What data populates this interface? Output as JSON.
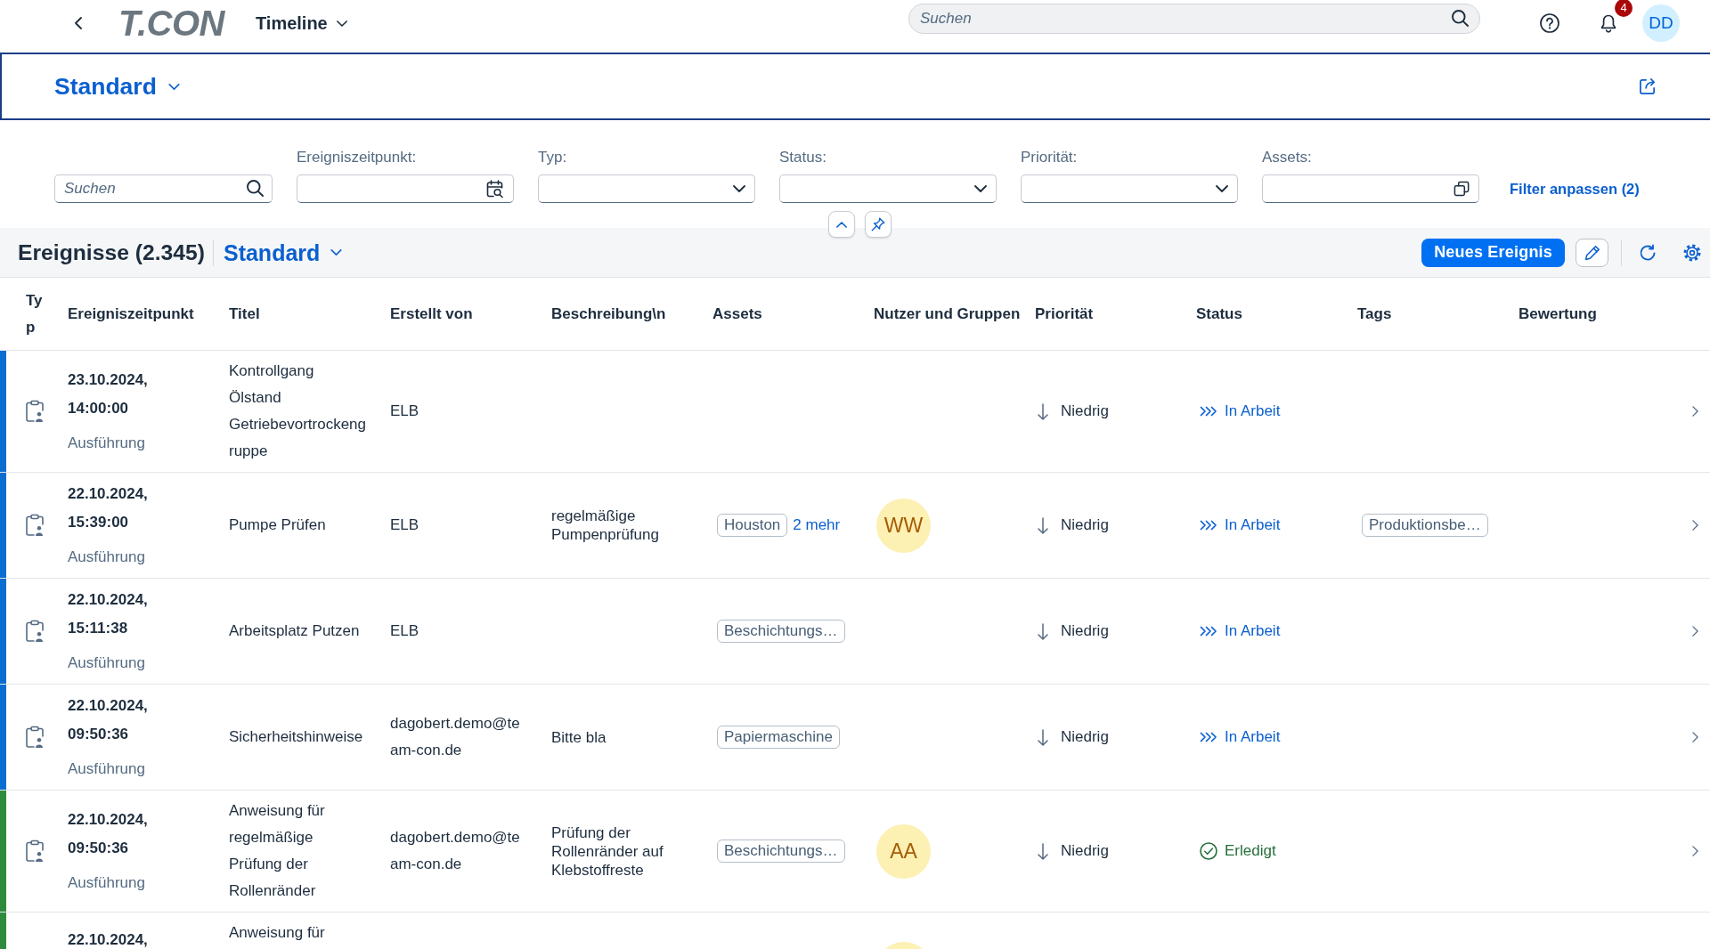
{
  "shell": {
    "logo": "T.CON",
    "app_title": "Timeline",
    "search": {
      "placeholder": "Suchen"
    },
    "notifications": {
      "count": "4"
    },
    "user": {
      "initials": "DD"
    }
  },
  "variant_header": {
    "title": "Standard"
  },
  "filter_bar": {
    "search": {
      "placeholder": "Suchen"
    },
    "fields": [
      {
        "label": "Ereigniszeitpunkt:",
        "kind": "date"
      },
      {
        "label": "Typ:",
        "kind": "select"
      },
      {
        "label": "Status:",
        "kind": "select"
      },
      {
        "label": "Priorität:",
        "kind": "select"
      },
      {
        "label": "Assets:",
        "kind": "value_help"
      }
    ],
    "adapt_filters": "Filter anpassen (2)"
  },
  "table": {
    "title": "Ereignisse (2.345)",
    "variant": "Standard",
    "create_button": "Neues Ereignis",
    "columns": [
      "Typ",
      "Ereigniszeitpunkt",
      "Titel",
      "Erstellt von",
      "Beschreibung\\n",
      "Assets",
      "Nutzer und Gruppen",
      "Priorität",
      "Status",
      "Tags",
      "Bewertung"
    ],
    "rows": [
      {
        "color": "#0a6ed1",
        "type": "Ausführung",
        "date": "23.10.2024,",
        "time": "14:00:00",
        "title": "Kontrollgang Ölstand Getriebevortrockengruppe",
        "created_by": "ELB",
        "priority": {
          "kind": "low",
          "label": "Niedrig"
        },
        "status": {
          "kind": "in_progress",
          "label": "In Arbeit"
        }
      },
      {
        "color": "#0a6ed1",
        "type": "Ausführung",
        "date": "22.10.2024,",
        "time": "15:39:00",
        "title": "Pumpe Prüfen",
        "created_by": "ELB",
        "description": "regelmäßige Pumpenprüfung",
        "assets": {
          "items": [
            "Houston"
          ],
          "more": "2 mehr"
        },
        "users": [
          {
            "kind": "avatar",
            "initials": "WW"
          }
        ],
        "priority": {
          "kind": "low",
          "label": "Niedrig"
        },
        "status": {
          "kind": "in_progress",
          "label": "In Arbeit"
        },
        "tags": [
          "Produktionsbe…"
        ]
      },
      {
        "color": "#0a6ed1",
        "type": "Ausführung",
        "date": "22.10.2024,",
        "time": "15:11:38",
        "title": "Arbeitsplatz Putzen",
        "created_by": "ELB",
        "assets": {
          "items": [
            "Beschichtungs…"
          ]
        },
        "priority": {
          "kind": "low",
          "label": "Niedrig"
        },
        "status": {
          "kind": "in_progress",
          "label": "In Arbeit"
        }
      },
      {
        "color": "#0a6ed1",
        "type": "Ausführung",
        "date": "22.10.2024,",
        "time": "09:50:36",
        "title": "Sicherheitshinweise",
        "created_by": "dagobert.demo@team-con.de",
        "description": "Bitte bla",
        "assets": {
          "items": [
            "Papiermaschine"
          ]
        },
        "priority": {
          "kind": "low",
          "label": "Niedrig"
        },
        "status": {
          "kind": "in_progress",
          "label": "In Arbeit"
        }
      },
      {
        "color": "#2e8b3e",
        "type": "Ausführung",
        "date": "22.10.2024,",
        "time": "09:50:36",
        "title": "Anweisung für regelmäßige Prüfung der Rollenränder",
        "created_by": "dagobert.demo@team-con.de",
        "description": "Prüfung der Rollenränder auf Klebstoffreste",
        "assets": {
          "items": [
            "Beschichtungs…"
          ]
        },
        "users": [
          {
            "kind": "avatar",
            "initials": "AA"
          }
        ],
        "priority": {
          "kind": "low",
          "label": "Niedrig"
        },
        "status": {
          "kind": "done",
          "label": "Erledigt"
        }
      },
      {
        "color": "#2e8b3e",
        "date": "22.10.2024,",
        "title": "Anweisung für",
        "users": [
          {
            "kind": "avatar"
          }
        ]
      }
    ]
  }
}
